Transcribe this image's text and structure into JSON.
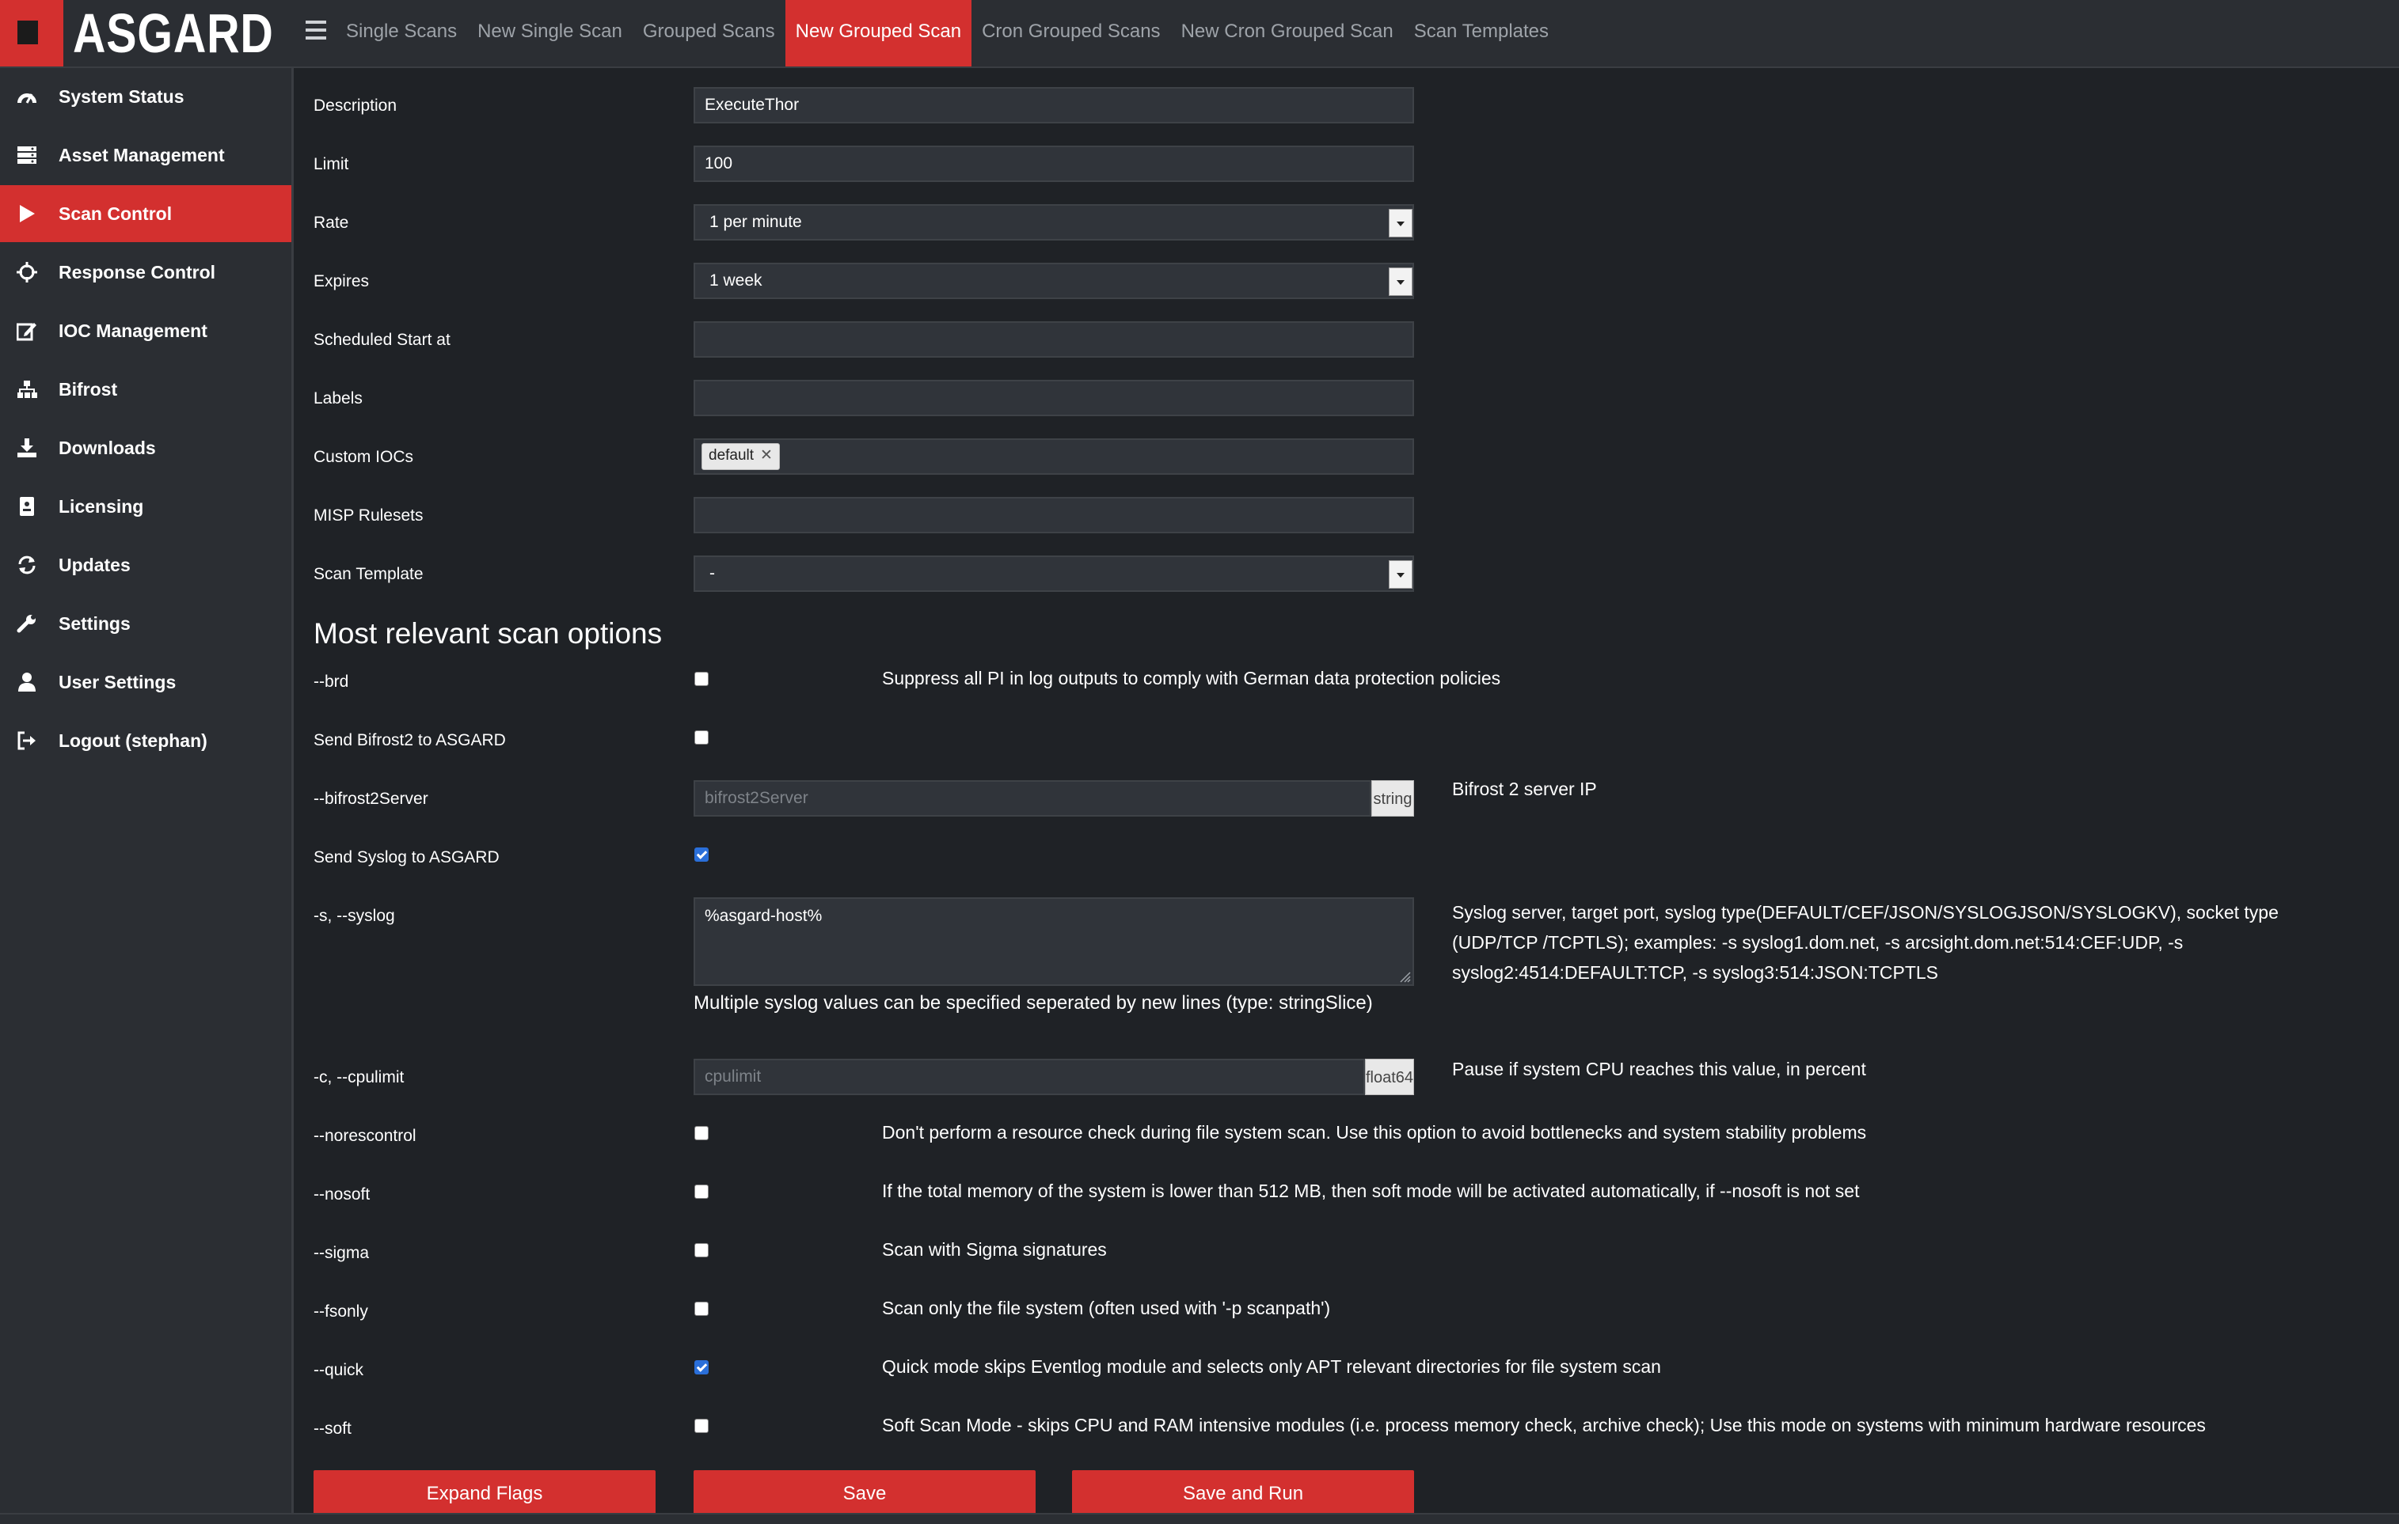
{
  "app": {
    "logo": "ASGARD"
  },
  "colors": {
    "accent": "#d3302f",
    "background": "#1f2226",
    "panel": "#2b2e33",
    "checkbox_on": "#2a6fd9"
  },
  "topnav": {
    "menu_icon": "hamburger-icon",
    "tabs": [
      {
        "label": "Single Scans"
      },
      {
        "label": "New Single Scan"
      },
      {
        "label": "Grouped Scans"
      },
      {
        "label": "New Grouped Scan",
        "active": true
      },
      {
        "label": "Cron Grouped Scans"
      },
      {
        "label": "New Cron Grouped Scan"
      },
      {
        "label": "Scan Templates"
      }
    ]
  },
  "sidebar": {
    "items": [
      {
        "label": "System Status",
        "icon": "dashboard-icon"
      },
      {
        "label": "Asset Management",
        "icon": "server-icon"
      },
      {
        "label": "Scan Control",
        "icon": "play-icon",
        "active": true
      },
      {
        "label": "Response Control",
        "icon": "crosshair-icon"
      },
      {
        "label": "IOC Management",
        "icon": "edit-icon"
      },
      {
        "label": "Bifrost",
        "icon": "sitemap-icon"
      },
      {
        "label": "Downloads",
        "icon": "download-icon"
      },
      {
        "label": "Licensing",
        "icon": "license-icon"
      },
      {
        "label": "Updates",
        "icon": "refresh-icon"
      },
      {
        "label": "Settings",
        "icon": "wrench-icon"
      },
      {
        "label": "User Settings",
        "icon": "user-icon"
      },
      {
        "label": "Logout (stephan)",
        "icon": "logout-icon"
      }
    ]
  },
  "form": {
    "description": {
      "label": "Description",
      "value": "ExecuteThor"
    },
    "limit": {
      "label": "Limit",
      "value": "100"
    },
    "rate": {
      "label": "Rate",
      "value": "1 per minute"
    },
    "expires": {
      "label": "Expires",
      "value": "1 week"
    },
    "scheduled_start": {
      "label": "Scheduled Start at",
      "value": ""
    },
    "labels": {
      "label": "Labels",
      "value": ""
    },
    "custom_iocs": {
      "label": "Custom IOCs",
      "tags": [
        "default"
      ]
    },
    "misp_rulesets": {
      "label": "MISP Rulesets",
      "value": ""
    },
    "scan_template": {
      "label": "Scan Template",
      "value": "-"
    }
  },
  "options": {
    "title": "Most relevant scan options",
    "brd": {
      "label": "--brd",
      "checked": false,
      "desc": "Suppress all PI in log outputs to comply with German data protection policies"
    },
    "send_bifrost2": {
      "label": "Send Bifrost2 to ASGARD",
      "checked": false
    },
    "bifrost2server": {
      "label": "--bifrost2Server",
      "placeholder": "bifrost2Server",
      "type": "string",
      "desc": "Bifrost 2 server IP"
    },
    "send_syslog": {
      "label": "Send Syslog to ASGARD",
      "checked": true
    },
    "syslog": {
      "label": "-s, --syslog",
      "value": "%asgard-host%",
      "desc": "Syslog server, target port, syslog type(DEFAULT/CEF/JSON/SYSLOGJSON/SYSLOGKV), socket type (UDP/TCP /TCPTLS); examples: -s syslog1.dom.net, -s arcsight.dom.net:514:CEF:UDP, -s syslog2:4514:DEFAULT:TCP, -s syslog3:514:JSON:TCPTLS",
      "hint": "Multiple syslog values can be specified seperated by new lines (type: stringSlice)"
    },
    "cpulimit": {
      "label": "-c, --cpulimit",
      "placeholder": "cpulimit",
      "type": "float64",
      "desc": "Pause if system CPU reaches this value, in percent"
    },
    "norescontrol": {
      "label": "--norescontrol",
      "checked": false,
      "desc": "Don't perform a resource check during file system scan. Use this option to avoid bottlenecks and system stability problems"
    },
    "nosoft": {
      "label": "--nosoft",
      "checked": false,
      "desc": "If the total memory of the system is lower than 512 MB, then soft mode will be activated automatically, if --nosoft is not set"
    },
    "sigma": {
      "label": "--sigma",
      "checked": false,
      "desc": "Scan with Sigma signatures"
    },
    "fsonly": {
      "label": "--fsonly",
      "checked": false,
      "desc": "Scan only the file system (often used with '-p scanpath')"
    },
    "quick": {
      "label": "--quick",
      "checked": true,
      "desc": "Quick mode skips Eventlog module and selects only APT relevant directories for file system scan"
    },
    "soft": {
      "label": "--soft",
      "checked": false,
      "desc": "Soft Scan Mode - skips CPU and RAM intensive modules (i.e. process memory check, archive check); Use this mode on systems with minimum hardware resources"
    }
  },
  "buttons": {
    "expand_flags": "Expand Flags",
    "save": "Save",
    "save_and_run": "Save and Run"
  }
}
